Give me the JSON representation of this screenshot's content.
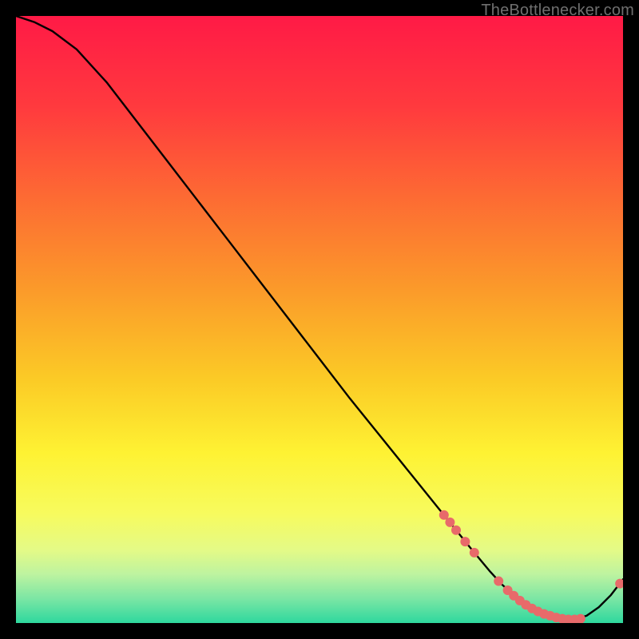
{
  "watermark": "TheBottlenecker.com",
  "chart_data": {
    "type": "line",
    "title": "",
    "xlabel": "",
    "ylabel": "",
    "xlim": [
      0,
      100
    ],
    "ylim": [
      0,
      100
    ],
    "x": [
      0,
      3,
      6,
      10,
      15,
      20,
      25,
      30,
      35,
      40,
      45,
      50,
      55,
      60,
      65,
      70,
      75,
      78,
      80,
      82,
      84,
      86,
      88,
      90,
      92,
      94,
      96,
      98,
      100
    ],
    "values": [
      100,
      99,
      97.5,
      94.5,
      89,
      82.5,
      76,
      69.5,
      63,
      56.5,
      50,
      43.5,
      37,
      30.8,
      24.6,
      18.4,
      12.2,
      8.6,
      6.4,
      4.6,
      3.1,
      2.0,
      1.2,
      0.7,
      0.6,
      1.2,
      2.6,
      4.6,
      7.2
    ],
    "markers": {
      "x": [
        70.5,
        71.5,
        72.5,
        74,
        75.5,
        79.5,
        81,
        82,
        83,
        84,
        85,
        86,
        87,
        88,
        89,
        90,
        91,
        92,
        93,
        99.5
      ],
      "y": [
        17.8,
        16.6,
        15.3,
        13.4,
        11.6,
        6.9,
        5.4,
        4.5,
        3.7,
        3.0,
        2.4,
        1.9,
        1.5,
        1.2,
        0.9,
        0.7,
        0.6,
        0.6,
        0.7,
        6.5
      ]
    },
    "marker_color": "#e86a6a",
    "line_color": "#000000",
    "gradient_stops": [
      {
        "offset": 0.0,
        "color": "#ff1a46"
      },
      {
        "offset": 0.15,
        "color": "#ff3a3e"
      },
      {
        "offset": 0.3,
        "color": "#fd6b33"
      },
      {
        "offset": 0.45,
        "color": "#fb9a2a"
      },
      {
        "offset": 0.6,
        "color": "#fbcb26"
      },
      {
        "offset": 0.72,
        "color": "#fef233"
      },
      {
        "offset": 0.82,
        "color": "#f7fb5e"
      },
      {
        "offset": 0.88,
        "color": "#e4fa87"
      },
      {
        "offset": 0.92,
        "color": "#bdf3a0"
      },
      {
        "offset": 0.96,
        "color": "#7be6a4"
      },
      {
        "offset": 1.0,
        "color": "#2ed89e"
      }
    ]
  }
}
